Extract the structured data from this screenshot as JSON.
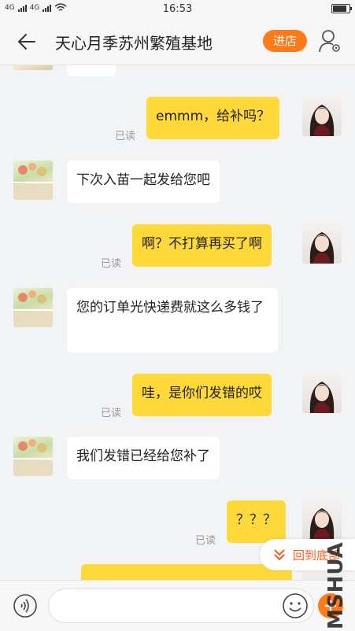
{
  "status_bar": {
    "signal_left": "4G",
    "signal_right": "4G",
    "time": "16:53"
  },
  "header": {
    "title": "天心月季苏州繁殖基地",
    "shop_button": "进店",
    "back_icon": "back-arrow-icon",
    "profile_icon": "profile-settings-icon"
  },
  "messages": [
    {
      "side": "in",
      "text": ""
    },
    {
      "side": "out",
      "text": "emmm，给补吗？",
      "status": "已读"
    },
    {
      "side": "in",
      "text": "下次入苗一起发给您吧"
    },
    {
      "side": "out",
      "text": "啊？不打算再买了啊",
      "status": "已读"
    },
    {
      "side": "in",
      "text": "您的订单光快递费就这么多钱了"
    },
    {
      "side": "out",
      "text": "哇，是你们发错的哎",
      "status": "已读"
    },
    {
      "side": "in",
      "text": "我们发错已经给您补了"
    },
    {
      "side": "out",
      "text": "？？？",
      "status": "已读"
    },
    {
      "side": "out",
      "text": ""
    }
  ],
  "jump_button": {
    "label": "回到底部"
  },
  "input_bar": {
    "placeholder": "",
    "voice_icon": "voice-icon",
    "emoji_icon": "emoji-icon",
    "plus_icon": "plus-icon"
  },
  "watermark": "MSHUA",
  "colors": {
    "accent": "#ff7a1a",
    "outgoing_bubble": "#ffd83a",
    "incoming_bubble": "#ffffff",
    "background": "#f2f3f5"
  }
}
